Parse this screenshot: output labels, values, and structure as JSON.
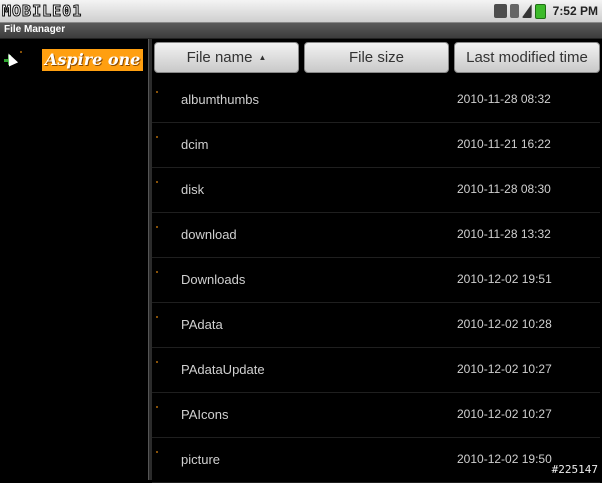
{
  "status_bar": {
    "watermark": "MOBILE01",
    "time": "7:52 PM"
  },
  "window": {
    "title": "File Manager"
  },
  "tree": {
    "root_label": "Aspire one"
  },
  "columns": {
    "name": "File name",
    "name_sort_indicator": "▲",
    "size": "File size",
    "modified": "Last modified time"
  },
  "files": [
    {
      "name": "albumthumbs",
      "modified": "2010-11-28 08:32"
    },
    {
      "name": "dcim",
      "modified": "2010-11-21 16:22"
    },
    {
      "name": "disk",
      "modified": "2010-11-28 08:30"
    },
    {
      "name": "download",
      "modified": "2010-11-28 13:32"
    },
    {
      "name": "Downloads",
      "modified": "2010-12-02 19:51"
    },
    {
      "name": "PAdata",
      "modified": "2010-12-02 10:28"
    },
    {
      "name": "PAdataUpdate",
      "modified": "2010-12-02 10:27"
    },
    {
      "name": "PAIcons",
      "modified": "2010-12-02 10:27"
    },
    {
      "name": "picture",
      "modified": "2010-12-02 19:50"
    }
  ],
  "image_id": "#225147"
}
